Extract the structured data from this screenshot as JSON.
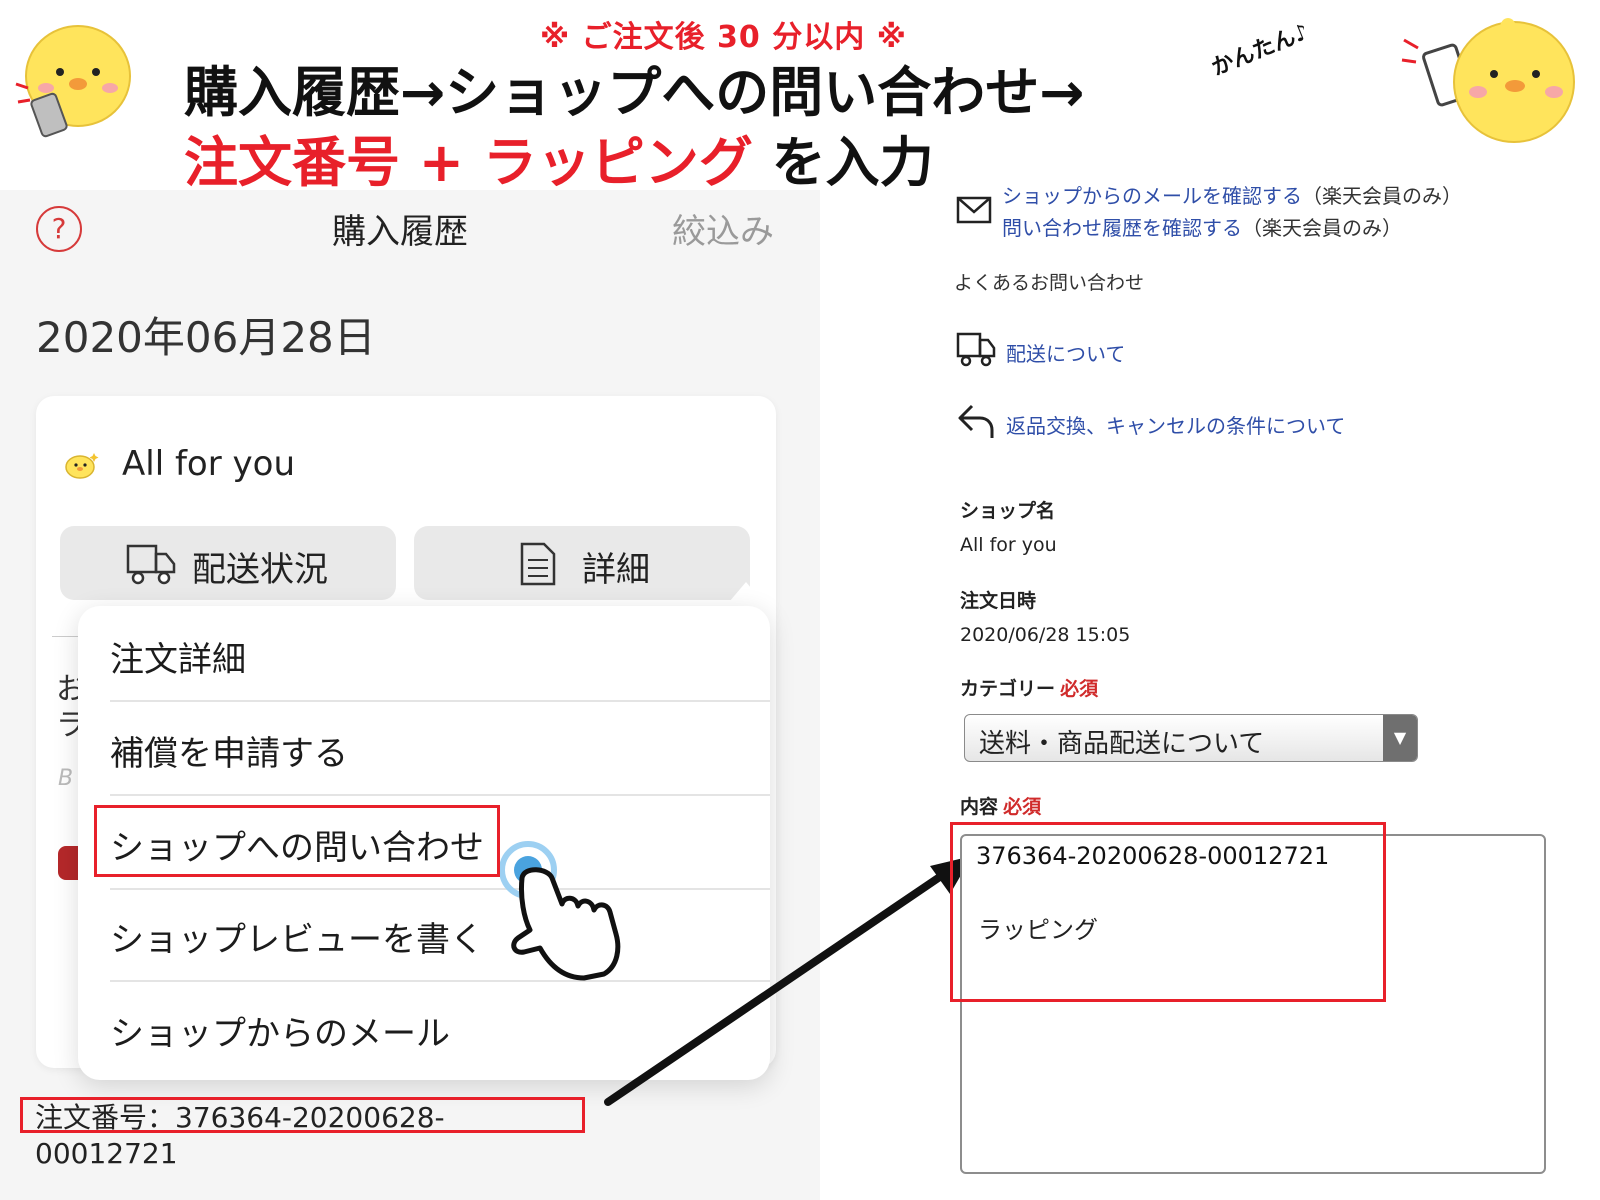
{
  "banner": {
    "note": "※ ご注文後 30 分以内 ※",
    "title_line1": "購入履歴→ショップへの問い合わせ→",
    "title_line2_red": "注文番号 + ラッピング",
    "title_line2_black": "を入力",
    "kantan": "かんたん♪"
  },
  "left": {
    "nav": {
      "help_glyph": "?",
      "title": "購入履歴",
      "filter": "絞込み"
    },
    "date": "2020年06月28日",
    "shop_name": "All for you",
    "buttons": {
      "delivery": "配送状況",
      "detail": "詳細"
    },
    "partial_text": {
      "a": "お",
      "b": "ラ",
      "c": "B"
    },
    "menu": [
      {
        "label": "注文詳細"
      },
      {
        "label": "補償を申請する"
      },
      {
        "label": "ショップへの問い合わせ"
      },
      {
        "label": "ショップレビューを書く"
      },
      {
        "label": "ショップからのメール"
      }
    ],
    "order_number": "注文番号：376364-20200628-00012721"
  },
  "right": {
    "mail_link1": "ショップからのメールを確認する",
    "mail_link1_note": "（楽天会員のみ）",
    "mail_link2": "問い合わせ履歴を確認する",
    "mail_link2_note": "（楽天会員のみ）",
    "faq_heading": "よくあるお問い合わせ",
    "faq_delivery": "配送について",
    "faq_return": "返品交換、キャンセルの条件について",
    "shop_label": "ショップ名",
    "shop_value": "All for you",
    "date_label": "注文日時",
    "date_value": "2020/06/28 15:05",
    "category_label": "カテゴリー",
    "required": "必須",
    "category_value": "送料・商品配送について",
    "content_label": "内容",
    "content_line1": "376364-20200628-00012721",
    "content_line2": "ラッピング"
  },
  "colors": {
    "accent_red": "#e8202a",
    "link_blue": "#2f4ea8",
    "touch_ring": "#4aa3df"
  }
}
